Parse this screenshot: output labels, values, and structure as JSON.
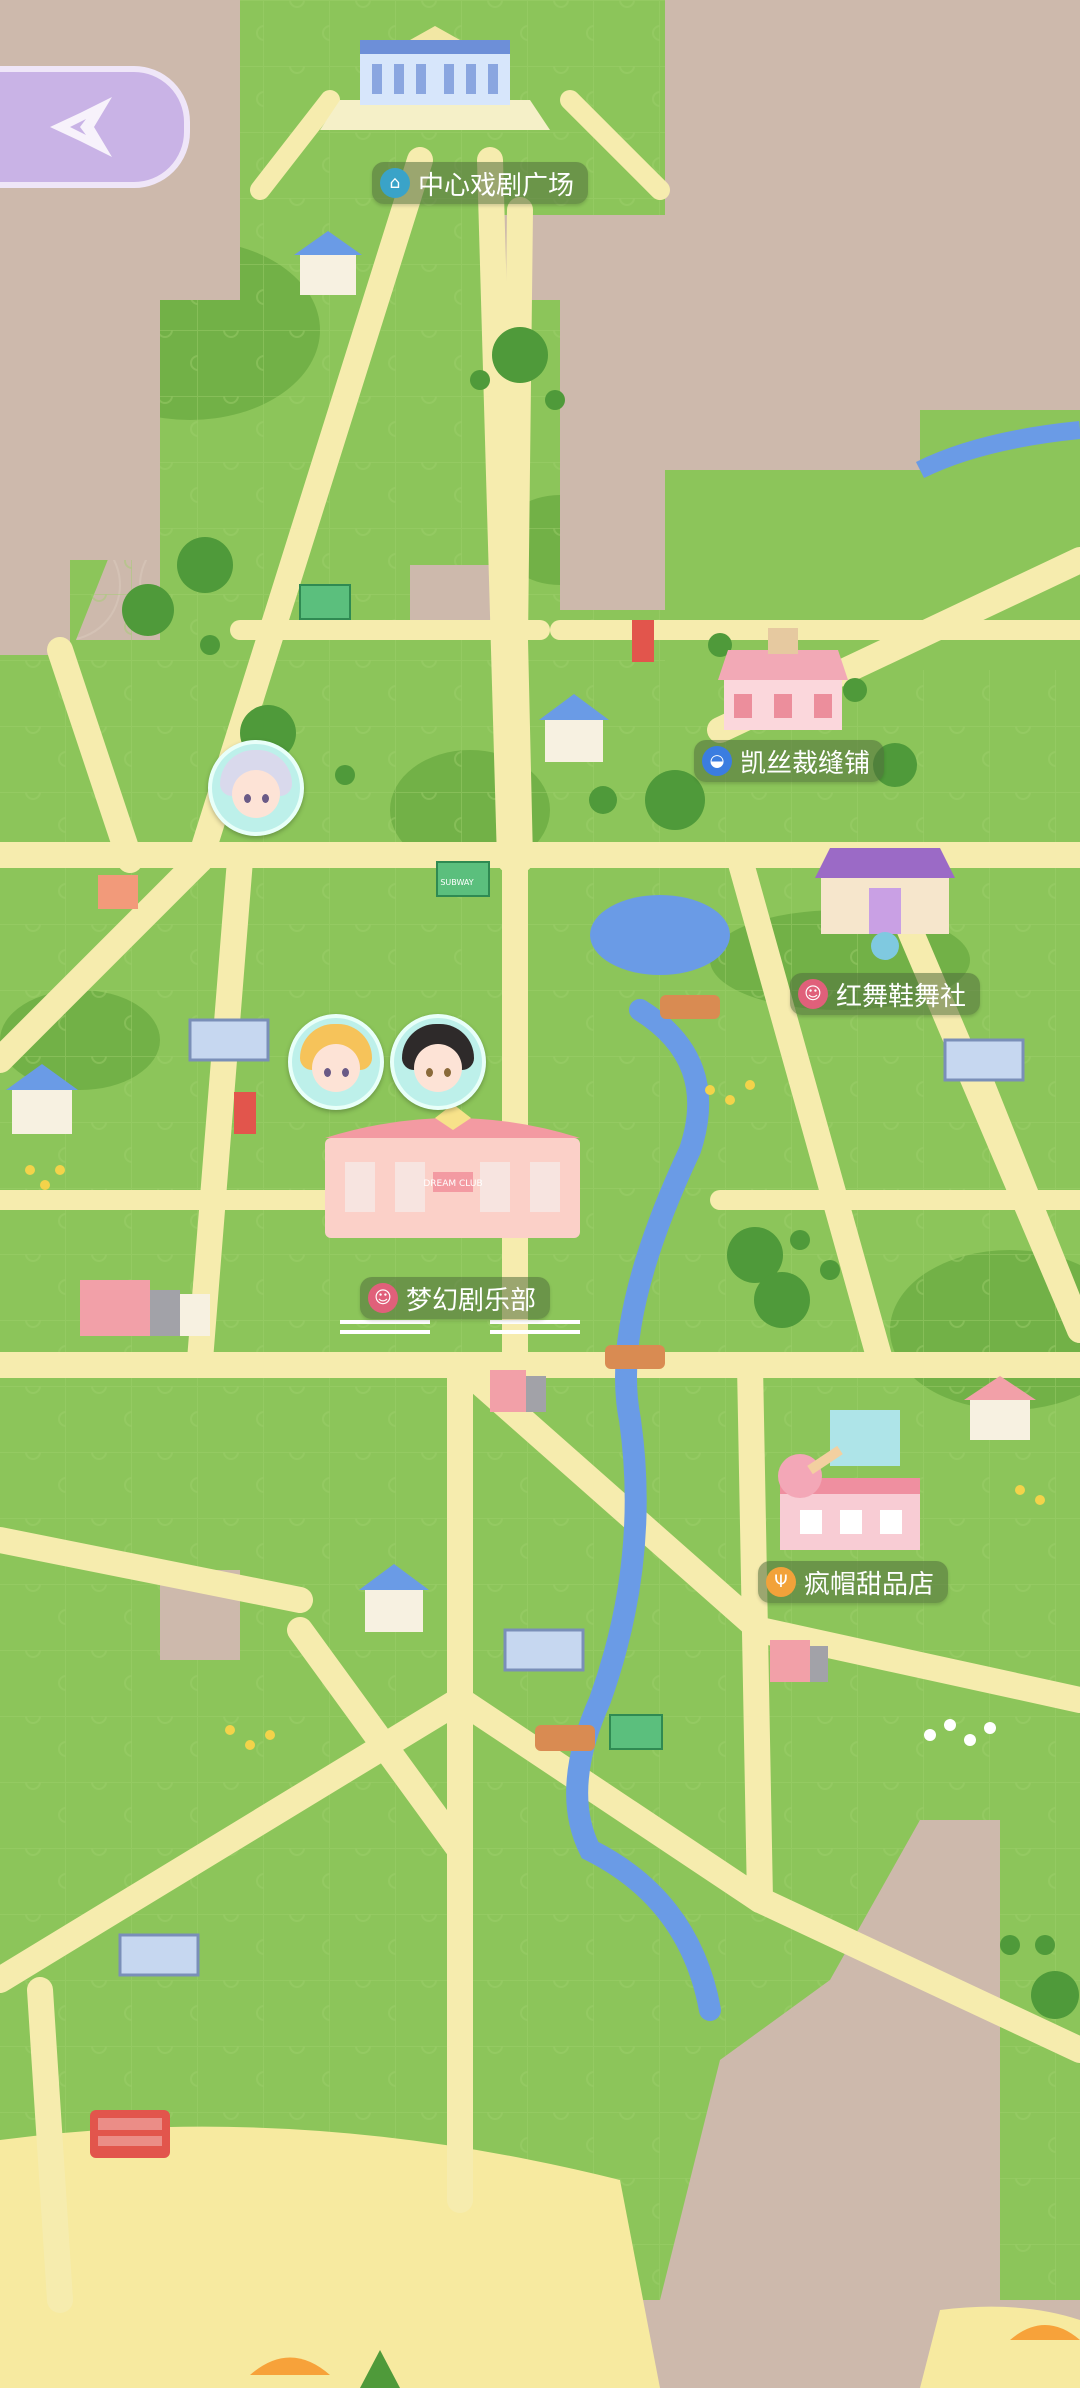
{
  "nav": {
    "back_icon": "compass-star-icon"
  },
  "locations": [
    {
      "id": "theater-plaza",
      "label": "中心戏剧广场",
      "icon": "museum-icon",
      "badge_color": "#3aa3c8"
    },
    {
      "id": "kaisi-tailor",
      "label": "凯丝裁缝铺",
      "icon": "shopping-bag-icon",
      "badge_color": "#3b7de0"
    },
    {
      "id": "hongwu-dance",
      "label": "红舞鞋舞社",
      "icon": "theater-mask-icon",
      "badge_color": "#e0607a"
    },
    {
      "id": "dream-club",
      "label": "梦幻剧乐部",
      "icon": "theater-mask-icon",
      "badge_color": "#e0607a"
    },
    {
      "id": "mad-hat-dessert",
      "label": "疯帽甜品店",
      "icon": "fork-knife-icon",
      "badge_color": "#f2a23a"
    }
  ],
  "signs": {
    "subway": "SUBWAY",
    "club_sign": "DREAM CLUB"
  },
  "colors": {
    "grass": "#8cc55a",
    "grass_dark": "#6fae45",
    "road": "#f6ecae",
    "river": "#6a9be6",
    "locked": "#cdb9ac"
  }
}
